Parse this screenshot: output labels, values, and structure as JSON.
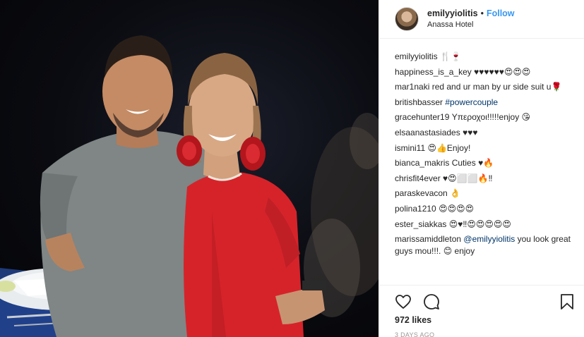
{
  "header": {
    "username": "emilyyiolitis",
    "separator": "•",
    "follow_label": "Follow",
    "location": "Anassa Hotel"
  },
  "comments": [
    {
      "user": "emilyyiolitis",
      "text": "🍴🍷",
      "type": "caption"
    },
    {
      "user": "happiness_is_a_key",
      "text": "♥♥♥♥♥♥😍😍😍"
    },
    {
      "user": "mar1naki",
      "text": "red and ur man by ur side suit u🌹"
    },
    {
      "user": "britishbasser",
      "text": "",
      "tag": "#powercouple"
    },
    {
      "user": "gracehunter19",
      "text": "Υπεροχοι!!!!!enjoy 😘"
    },
    {
      "user": "elsaanastasiades",
      "text": "♥♥♥"
    },
    {
      "user": "ismini11",
      "text": "😍👍Enjoy!"
    },
    {
      "user": "bianca_makris",
      "text": "Cuties ♥🔥"
    },
    {
      "user": "chrisfit4ever",
      "text": "♥😍⬜⬜🔥‼"
    },
    {
      "user": "paraskevacon",
      "text": "👌"
    },
    {
      "user": "polina1210",
      "text": "😍😍😍😍"
    },
    {
      "user": "ester_siakkas",
      "text": "😍♥‼😍😍😍😍😍"
    },
    {
      "user": "marissamiddleton",
      "tag": "@emilyyiolitis",
      "text": " you look great guys mou!!!. 😊 enjoy"
    }
  ],
  "actions": {
    "like_icon": "heart-icon",
    "comment_icon": "comment-icon",
    "save_icon": "bookmark-icon",
    "likes_text": "972 likes",
    "timestamp": "3 DAYS AGO"
  },
  "colors": {
    "link_blue": "#3897f0",
    "hashtag_blue": "#003569",
    "border": "#efefef",
    "text": "#262626",
    "muted": "#999999"
  }
}
